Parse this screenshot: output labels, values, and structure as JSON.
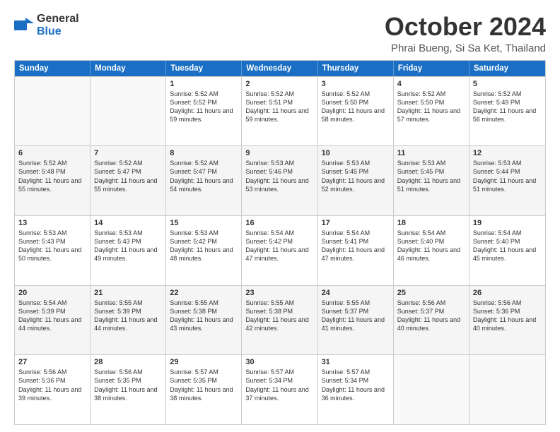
{
  "logo": {
    "line1": "General",
    "line2": "Blue"
  },
  "title": "October 2024",
  "location": "Phrai Bueng, Si Sa Ket, Thailand",
  "weekdays": [
    "Sunday",
    "Monday",
    "Tuesday",
    "Wednesday",
    "Thursday",
    "Friday",
    "Saturday"
  ],
  "weeks": [
    [
      {
        "day": "",
        "text": ""
      },
      {
        "day": "",
        "text": ""
      },
      {
        "day": "1",
        "text": "Sunrise: 5:52 AM\nSunset: 5:52 PM\nDaylight: 11 hours and 59 minutes."
      },
      {
        "day": "2",
        "text": "Sunrise: 5:52 AM\nSunset: 5:51 PM\nDaylight: 11 hours and 59 minutes."
      },
      {
        "day": "3",
        "text": "Sunrise: 5:52 AM\nSunset: 5:50 PM\nDaylight: 11 hours and 58 minutes."
      },
      {
        "day": "4",
        "text": "Sunrise: 5:52 AM\nSunset: 5:50 PM\nDaylight: 11 hours and 57 minutes."
      },
      {
        "day": "5",
        "text": "Sunrise: 5:52 AM\nSunset: 5:49 PM\nDaylight: 11 hours and 56 minutes."
      }
    ],
    [
      {
        "day": "6",
        "text": "Sunrise: 5:52 AM\nSunset: 5:48 PM\nDaylight: 11 hours and 55 minutes."
      },
      {
        "day": "7",
        "text": "Sunrise: 5:52 AM\nSunset: 5:47 PM\nDaylight: 11 hours and 55 minutes."
      },
      {
        "day": "8",
        "text": "Sunrise: 5:52 AM\nSunset: 5:47 PM\nDaylight: 11 hours and 54 minutes."
      },
      {
        "day": "9",
        "text": "Sunrise: 5:53 AM\nSunset: 5:46 PM\nDaylight: 11 hours and 53 minutes."
      },
      {
        "day": "10",
        "text": "Sunrise: 5:53 AM\nSunset: 5:45 PM\nDaylight: 11 hours and 52 minutes."
      },
      {
        "day": "11",
        "text": "Sunrise: 5:53 AM\nSunset: 5:45 PM\nDaylight: 11 hours and 51 minutes."
      },
      {
        "day": "12",
        "text": "Sunrise: 5:53 AM\nSunset: 5:44 PM\nDaylight: 11 hours and 51 minutes."
      }
    ],
    [
      {
        "day": "13",
        "text": "Sunrise: 5:53 AM\nSunset: 5:43 PM\nDaylight: 11 hours and 50 minutes."
      },
      {
        "day": "14",
        "text": "Sunrise: 5:53 AM\nSunset: 5:43 PM\nDaylight: 11 hours and 49 minutes."
      },
      {
        "day": "15",
        "text": "Sunrise: 5:53 AM\nSunset: 5:42 PM\nDaylight: 11 hours and 48 minutes."
      },
      {
        "day": "16",
        "text": "Sunrise: 5:54 AM\nSunset: 5:42 PM\nDaylight: 11 hours and 47 minutes."
      },
      {
        "day": "17",
        "text": "Sunrise: 5:54 AM\nSunset: 5:41 PM\nDaylight: 11 hours and 47 minutes."
      },
      {
        "day": "18",
        "text": "Sunrise: 5:54 AM\nSunset: 5:40 PM\nDaylight: 11 hours and 46 minutes."
      },
      {
        "day": "19",
        "text": "Sunrise: 5:54 AM\nSunset: 5:40 PM\nDaylight: 11 hours and 45 minutes."
      }
    ],
    [
      {
        "day": "20",
        "text": "Sunrise: 5:54 AM\nSunset: 5:39 PM\nDaylight: 11 hours and 44 minutes."
      },
      {
        "day": "21",
        "text": "Sunrise: 5:55 AM\nSunset: 5:39 PM\nDaylight: 11 hours and 44 minutes."
      },
      {
        "day": "22",
        "text": "Sunrise: 5:55 AM\nSunset: 5:38 PM\nDaylight: 11 hours and 43 minutes."
      },
      {
        "day": "23",
        "text": "Sunrise: 5:55 AM\nSunset: 5:38 PM\nDaylight: 11 hours and 42 minutes."
      },
      {
        "day": "24",
        "text": "Sunrise: 5:55 AM\nSunset: 5:37 PM\nDaylight: 11 hours and 41 minutes."
      },
      {
        "day": "25",
        "text": "Sunrise: 5:56 AM\nSunset: 5:37 PM\nDaylight: 11 hours and 40 minutes."
      },
      {
        "day": "26",
        "text": "Sunrise: 5:56 AM\nSunset: 5:36 PM\nDaylight: 11 hours and 40 minutes."
      }
    ],
    [
      {
        "day": "27",
        "text": "Sunrise: 5:56 AM\nSunset: 5:36 PM\nDaylight: 11 hours and 39 minutes."
      },
      {
        "day": "28",
        "text": "Sunrise: 5:56 AM\nSunset: 5:35 PM\nDaylight: 11 hours and 38 minutes."
      },
      {
        "day": "29",
        "text": "Sunrise: 5:57 AM\nSunset: 5:35 PM\nDaylight: 11 hours and 38 minutes."
      },
      {
        "day": "30",
        "text": "Sunrise: 5:57 AM\nSunset: 5:34 PM\nDaylight: 11 hours and 37 minutes."
      },
      {
        "day": "31",
        "text": "Sunrise: 5:57 AM\nSunset: 5:34 PM\nDaylight: 11 hours and 36 minutes."
      },
      {
        "day": "",
        "text": ""
      },
      {
        "day": "",
        "text": ""
      }
    ]
  ]
}
